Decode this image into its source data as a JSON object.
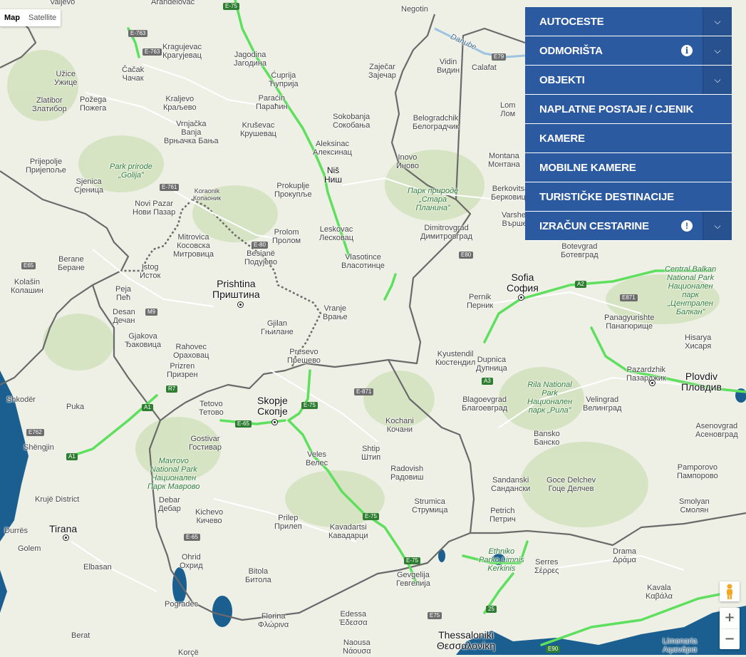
{
  "map_type": {
    "map": "Map",
    "satellite": "Satellite",
    "active": "map"
  },
  "menu": [
    {
      "label": "AUTOCESTE",
      "icon": "",
      "chevron": true
    },
    {
      "label": "ODMORIŠTA",
      "icon": "info-icon",
      "chevron": true
    },
    {
      "label": "OBJEKTI",
      "icon": "",
      "chevron": true
    },
    {
      "label": "NAPLATNE POSTAJE / CJENIK",
      "icon": "",
      "chevron": false
    },
    {
      "label": "KAMERE",
      "icon": "",
      "chevron": false
    },
    {
      "label": "MOBILNE KAMERE",
      "icon": "",
      "chevron": false
    },
    {
      "label": "TURISTIČKE DESTINACIJE",
      "icon": "",
      "chevron": false
    },
    {
      "label": "IZRAČUN CESTARINE",
      "icon": "warning-icon",
      "chevron": true
    }
  ],
  "zoom": {
    "in": "+",
    "out": "−"
  },
  "colors": {
    "menu_bg": "#2c5aa0",
    "motorway": "#5ee05e",
    "border": "#6a6a6a",
    "water": "#1a5f8f",
    "land": "#eef0e6"
  },
  "places": [
    {
      "id": "valjevo",
      "lines": [
        "Valjevo"
      ]
    },
    {
      "id": "arandjelovac",
      "lines": [
        "Aranđelovac"
      ]
    },
    {
      "id": "kragujevac",
      "lines": [
        "Kragujevac",
        "Крагујевац"
      ]
    },
    {
      "id": "jagodina",
      "lines": [
        "Jagodina",
        "Јагодина"
      ]
    },
    {
      "id": "negotin",
      "lines": [
        "Negotin"
      ]
    },
    {
      "id": "zajecar",
      "lines": [
        "Zaječar",
        "Зајечар"
      ]
    },
    {
      "id": "cuprija",
      "lines": [
        "Ćuprija",
        "Ћуприја"
      ]
    },
    {
      "id": "vidin",
      "lines": [
        "Vidin",
        "Видин"
      ]
    },
    {
      "id": "calafat",
      "lines": [
        "Calafat"
      ]
    },
    {
      "id": "cacak",
      "lines": [
        "Čačak",
        "Чачак"
      ]
    },
    {
      "id": "uzice",
      "lines": [
        "Užice",
        "Ужице"
      ]
    },
    {
      "id": "kraljevo",
      "lines": [
        "Kraljevo",
        "Краљево"
      ]
    },
    {
      "id": "pozega",
      "lines": [
        "Požega",
        "Пожега"
      ]
    },
    {
      "id": "zlatibor",
      "lines": [
        "Zlatibor",
        "Златибор"
      ]
    },
    {
      "id": "paracin",
      "lines": [
        "Paraćin",
        "Параћин"
      ]
    },
    {
      "id": "lom",
      "lines": [
        "Lom",
        "Лом"
      ]
    },
    {
      "id": "sokobanja",
      "lines": [
        "Sokobanja",
        "Сокобања"
      ]
    },
    {
      "id": "belogradchik",
      "lines": [
        "Belogradchik",
        "Белоградчик"
      ]
    },
    {
      "id": "vrnjacka",
      "lines": [
        "Vrnjačka",
        "Banja",
        "Врњачка Бања"
      ]
    },
    {
      "id": "krusevac",
      "lines": [
        "Kruševac",
        "Крушевац"
      ]
    },
    {
      "id": "aleksinac",
      "lines": [
        "Aleksinac",
        "Алексинац"
      ]
    },
    {
      "id": "prijepolje",
      "lines": [
        "Prijepolje",
        "Пријепоље"
      ]
    },
    {
      "id": "golija",
      "lines": [
        "Park prirode",
        "„Golija”"
      ]
    },
    {
      "id": "sjenica",
      "lines": [
        "Sjenica",
        "Сјеница"
      ]
    },
    {
      "id": "inovo",
      "lines": [
        "Inovo",
        "Иново"
      ]
    },
    {
      "id": "nis",
      "lines": [
        "Niš",
        "Ниш"
      ]
    },
    {
      "id": "montana",
      "lines": [
        "Montana",
        "Монтана"
      ]
    },
    {
      "id": "koraonik",
      "lines": [
        "Koraonik",
        "Копаоник"
      ]
    },
    {
      "id": "prokuplje",
      "lines": [
        "Prokuplje",
        "Прокупље"
      ]
    },
    {
      "id": "stara_planina",
      "lines": [
        "Парк природе",
        "„Стара",
        "Планина”"
      ]
    },
    {
      "id": "berkovitsa",
      "lines": [
        "Berkovitsa",
        "Берковица"
      ]
    },
    {
      "id": "novi_pazar",
      "lines": [
        "Novi Pazar",
        "Нови Пазар"
      ]
    },
    {
      "id": "vrshets",
      "lines": [
        "Varshets",
        "Вършец"
      ]
    },
    {
      "id": "leskovac",
      "lines": [
        "Leskovac",
        "Лесковац"
      ]
    },
    {
      "id": "prolom",
      "lines": [
        "Prolom",
        "Пролом"
      ]
    },
    {
      "id": "dimitrovgrad",
      "lines": [
        "Dimitrovgrad",
        "Димитровград"
      ]
    },
    {
      "id": "mitrovica",
      "lines": [
        "Mitrovica",
        "Косовска",
        "Митровица"
      ]
    },
    {
      "id": "besiane",
      "lines": [
        "Besianë",
        "Подујево"
      ]
    },
    {
      "id": "vlasotince",
      "lines": [
        "Vlasotince",
        "Власотинце"
      ]
    },
    {
      "id": "botevgrad",
      "lines": [
        "Botevgrad",
        "Ботевград"
      ]
    },
    {
      "id": "berane",
      "lines": [
        "Berane",
        "Беране"
      ]
    },
    {
      "id": "istog",
      "lines": [
        "Istog",
        "Исток"
      ]
    },
    {
      "id": "central_balkan",
      "lines": [
        "Central Balkan",
        "National Park",
        "Национален",
        "парк",
        "„Централен",
        "Балкан”"
      ]
    },
    {
      "id": "kolasin",
      "lines": [
        "Kolašin",
        "Колашин"
      ]
    },
    {
      "id": "sofia",
      "lines": [
        "Sofia",
        "София"
      ]
    },
    {
      "id": "pristina",
      "lines": [
        "Prishtina",
        "Приштина"
      ]
    },
    {
      "id": "peja",
      "lines": [
        "Peja",
        "Пећ"
      ]
    },
    {
      "id": "pernik",
      "lines": [
        "Pernik",
        "Перник"
      ]
    },
    {
      "id": "vranje",
      "lines": [
        "Vranje",
        "Врање"
      ]
    },
    {
      "id": "panagyurishte",
      "lines": [
        "Panagyurishte",
        "Панагюрище"
      ]
    },
    {
      "id": "desan",
      "lines": [
        "Desan",
        "Дечан"
      ]
    },
    {
      "id": "gjilan",
      "lines": [
        "Gjilan",
        "Гњилане"
      ]
    },
    {
      "id": "gjakova",
      "lines": [
        "Gjakova",
        "Ђаковица"
      ]
    },
    {
      "id": "hisarya",
      "lines": [
        "Hisarya",
        "Хисаря"
      ]
    },
    {
      "id": "rahovec",
      "lines": [
        "Rahovec",
        "Ораховац"
      ]
    },
    {
      "id": "presevo",
      "lines": [
        "Presevo",
        "Прешево"
      ]
    },
    {
      "id": "kyustendil",
      "lines": [
        "Kyustendil",
        "Кюстендил"
      ]
    },
    {
      "id": "prizren",
      "lines": [
        "Prizren",
        "Призрен"
      ]
    },
    {
      "id": "dupnica",
      "lines": [
        "Dupnica",
        "Дупница"
      ]
    },
    {
      "id": "pazardzhik",
      "lines": [
        "Pazardzhik",
        "Пазарджик"
      ]
    },
    {
      "id": "plovdiv",
      "lines": [
        "Plovdiv",
        "Пловдив"
      ]
    },
    {
      "id": "shkoder",
      "lines": [
        "Shkodër"
      ]
    },
    {
      "id": "skopje",
      "lines": [
        "Skopje",
        "Скопје"
      ]
    },
    {
      "id": "blagoevgrad",
      "lines": [
        "Blagoevgrad",
        "Благоевград"
      ]
    },
    {
      "id": "rila",
      "lines": [
        "Rila National",
        "Park",
        "Национален",
        "парк „Рила”"
      ]
    },
    {
      "id": "velingrad",
      "lines": [
        "Velingrad",
        "Велинград"
      ]
    },
    {
      "id": "tetovo",
      "lines": [
        "Tetovo",
        "Тетово"
      ]
    },
    {
      "id": "puka",
      "lines": [
        "Puka"
      ]
    },
    {
      "id": "asenovgrad",
      "lines": [
        "Asenovgrad",
        "Асеновград"
      ]
    },
    {
      "id": "kochani",
      "lines": [
        "Kochani",
        "Кочани"
      ]
    },
    {
      "id": "shengjin",
      "lines": [
        "Shëngjin"
      ]
    },
    {
      "id": "gostivar",
      "lines": [
        "Gostivar",
        "Гостивар"
      ]
    },
    {
      "id": "bansko",
      "lines": [
        "Bansko",
        "Банско"
      ]
    },
    {
      "id": "mavrovo",
      "lines": [
        "Mavrovo",
        "National Park",
        "Национален",
        "Парк Маврово"
      ]
    },
    {
      "id": "veles",
      "lines": [
        "Veles",
        "Велес"
      ]
    },
    {
      "id": "shtip",
      "lines": [
        "Shtip",
        "Штип"
      ]
    },
    {
      "id": "pamporovo",
      "lines": [
        "Pamporovo",
        "Пампорово"
      ]
    },
    {
      "id": "radovish",
      "lines": [
        "Radovish",
        "Радовиш"
      ]
    },
    {
      "id": "sandanski",
      "lines": [
        "Sandanski",
        "Сандански"
      ]
    },
    {
      "id": "goce_delchev",
      "lines": [
        "Goce Delchev",
        "Гоце Делчев"
      ]
    },
    {
      "id": "kruje",
      "lines": [
        "Krujë District"
      ]
    },
    {
      "id": "debar",
      "lines": [
        "Debar",
        "Дебар"
      ]
    },
    {
      "id": "strumica",
      "lines": [
        "Strumica",
        "Струмица"
      ]
    },
    {
      "id": "smolyan",
      "lines": [
        "Smolyan",
        "Смолян"
      ]
    },
    {
      "id": "kichevo",
      "lines": [
        "Kichevo",
        "Кичево"
      ]
    },
    {
      "id": "prilep",
      "lines": [
        "Prilep",
        "Прилеп"
      ]
    },
    {
      "id": "petrich",
      "lines": [
        "Petrich",
        "Петрич"
      ]
    },
    {
      "id": "durres",
      "lines": [
        "Durrës"
      ]
    },
    {
      "id": "tirana",
      "lines": [
        "Tirana"
      ]
    },
    {
      "id": "kavadartsi",
      "lines": [
        "Kavadartsi",
        "Кавадарци"
      ]
    },
    {
      "id": "golem",
      "lines": [
        "Golem"
      ]
    },
    {
      "id": "ethniko",
      "lines": [
        "Ethniko",
        "Parko Limnis",
        "Kerkinis"
      ]
    },
    {
      "id": "drama",
      "lines": [
        "Drama",
        "Δράμα"
      ]
    },
    {
      "id": "ohrid",
      "lines": [
        "Ohrid",
        "Охрид"
      ]
    },
    {
      "id": "serres",
      "lines": [
        "Serres",
        "Σέρρες"
      ]
    },
    {
      "id": "elbasan",
      "lines": [
        "Elbasan"
      ]
    },
    {
      "id": "bitola",
      "lines": [
        "Bitola",
        "Битола"
      ]
    },
    {
      "id": "gevgelija",
      "lines": [
        "Gevgelija",
        "Гевгелија"
      ]
    },
    {
      "id": "kavala",
      "lines": [
        "Kavala",
        "Καβάλα"
      ]
    },
    {
      "id": "pogradec",
      "lines": [
        "Pogradec"
      ]
    },
    {
      "id": "edessa",
      "lines": [
        "Edessa",
        "Έδεσσα"
      ]
    },
    {
      "id": "florina",
      "lines": [
        "Florina",
        "Φλώρινα"
      ]
    },
    {
      "id": "berat",
      "lines": [
        "Berat"
      ]
    },
    {
      "id": "nausa",
      "lines": [
        "Naousa",
        "Νάουσα"
      ]
    },
    {
      "id": "thessaloniki",
      "lines": [
        "Thessaloniki",
        "Θεσσαλονίκη"
      ]
    },
    {
      "id": "korce",
      "lines": [
        "Korçë"
      ]
    },
    {
      "id": "limenaria",
      "lines": [
        "Limenaria",
        "Λιμενάρια"
      ]
    },
    {
      "id": "danube",
      "lines": [
        "Danube"
      ]
    }
  ],
  "road_shields": [
    {
      "id": "e75_top",
      "text": "E-75",
      "style": "green"
    },
    {
      "id": "e763_a",
      "text": "E-763",
      "style": "gray"
    },
    {
      "id": "e763_b",
      "text": "E-763",
      "style": "gray"
    },
    {
      "id": "e79",
      "text": "E79",
      "style": "gray"
    },
    {
      "id": "e761",
      "text": "E-761",
      "style": "gray"
    },
    {
      "id": "e80_kos",
      "text": "E-80",
      "style": "gray"
    },
    {
      "id": "e80_bg",
      "text": "E80",
      "style": "gray"
    },
    {
      "id": "e65_mne",
      "text": "E65",
      "style": "gray"
    },
    {
      "id": "m9",
      "text": "M9",
      "style": "gray"
    },
    {
      "id": "a2",
      "text": "A2",
      "style": "green"
    },
    {
      "id": "e871_bg",
      "text": "E871",
      "style": "gray"
    },
    {
      "id": "a3",
      "text": "A3",
      "style": "green"
    },
    {
      "id": "r7",
      "text": "R7",
      "style": "green"
    },
    {
      "id": "e871_mk",
      "text": "E-871",
      "style": "gray"
    },
    {
      "id": "a1_kos",
      "text": "A1",
      "style": "green"
    },
    {
      "id": "e75_mk",
      "text": "E-75",
      "style": "green"
    },
    {
      "id": "e65_mk",
      "text": "E-65",
      "style": "green"
    },
    {
      "id": "e762",
      "text": "E762",
      "style": "gray"
    },
    {
      "id": "a1_alb",
      "text": "A1",
      "style": "green"
    },
    {
      "id": "e75_veles",
      "text": "E-75",
      "style": "green"
    },
    {
      "id": "e65_ohrid",
      "text": "E-65",
      "style": "gray"
    },
    {
      "id": "e75_gev",
      "text": "E-75",
      "style": "green"
    },
    {
      "id": "e75_gr",
      "text": "E75",
      "style": "gray"
    },
    {
      "id": "gr25",
      "text": "25",
      "style": "green"
    },
    {
      "id": "e90",
      "text": "E90",
      "style": "green"
    }
  ]
}
